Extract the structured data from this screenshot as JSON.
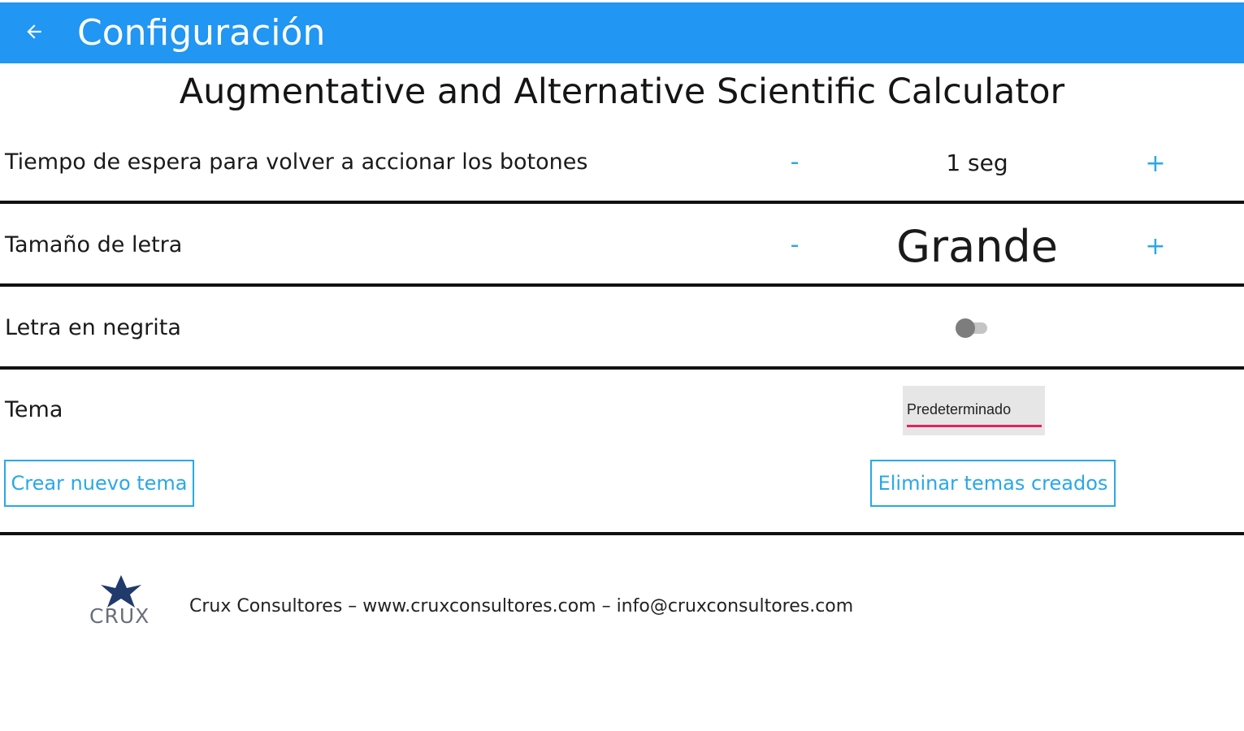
{
  "appbar": {
    "title": "Configuración",
    "back_icon": "arrow-left-icon",
    "color": "#2196f3"
  },
  "app_name": "Augmentative and Alternative Scientific Calculator",
  "settings": {
    "wait_time": {
      "label": "Tiempo de espera para volver a accionar los botones",
      "decrement": "-",
      "value": "1 seg",
      "increment": "+"
    },
    "font_size": {
      "label": "Tamaño de letra",
      "decrement": "-",
      "value": "Grande",
      "increment": "+"
    },
    "bold": {
      "label": "Letra en negrita",
      "enabled": false
    },
    "theme": {
      "label": "Tema",
      "selected": "Predeterminado",
      "create_button": "Crear nuevo tema",
      "delete_button": "Eliminar temas creados"
    }
  },
  "footer": {
    "logo_text": "CRUX",
    "logo_icon": "crux-star-icon",
    "text": "Crux Consultores – www.cruxconsultores.com – info@cruxconsultores.com"
  },
  "colors": {
    "accent": "#29a8e8",
    "underline": "#e91e63"
  }
}
